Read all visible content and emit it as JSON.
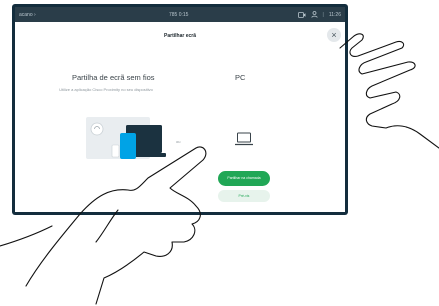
{
  "status_bar": {
    "left_label": "acano",
    "chevron": "›",
    "center_label": "785 0:15",
    "time": "11:26",
    "icons": [
      "camera-icon",
      "people-icon"
    ]
  },
  "dialog": {
    "title": "Partilhar ecrã",
    "close_icon": "close-icon",
    "wireless": {
      "heading": "Partilha de ecrã sem fios",
      "description": "Utilize a aplicação Cisco Proximity no seu dispositivo"
    },
    "or_label": "ou",
    "pc": {
      "heading": "PC",
      "icon": "laptop-icon"
    },
    "buttons": {
      "share_call": "Partilhar na chamada",
      "preview": "Pré-vis"
    }
  },
  "colors": {
    "frame": "#132d3d",
    "status_bar": "#2a3d49",
    "accent_green": "#21a756",
    "accent_blue": "#00a3e6"
  }
}
